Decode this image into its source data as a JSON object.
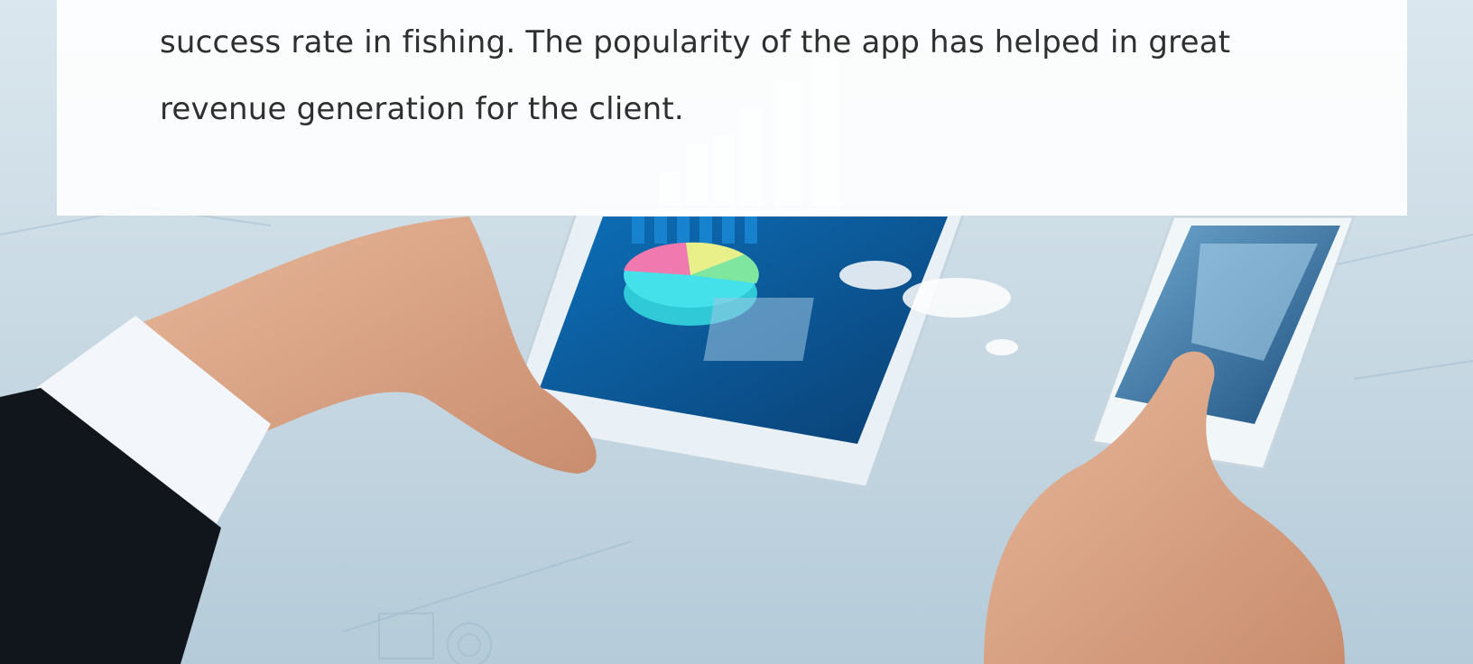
{
  "case_study": {
    "description_tail": "success rate in fishing. The popularity of the app has helped in great revenue generation for the client."
  },
  "hero_image": {
    "subject": "business-hands-using-tablet-and-smartphone",
    "overlay_color": "#ffffff",
    "text_color": "#2f2f2f"
  }
}
